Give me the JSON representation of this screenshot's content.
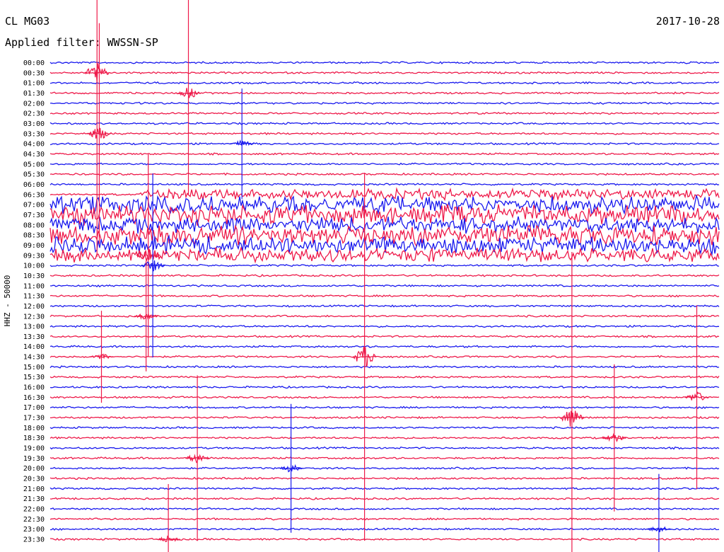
{
  "header": {
    "station": "CL MG03",
    "date": "2017-10-28",
    "filter_label": "Applied filter: WWSSN-SP"
  },
  "chart_data": {
    "type": "line",
    "title": "CL MG03",
    "subtitle": "Applied filter: WWSSN-SP",
    "ylabel": "HHZ - 50000",
    "xlabel": "",
    "y_ticks": [
      "00:00",
      "00:30",
      "01:00",
      "01:30",
      "02:00",
      "02:30",
      "03:00",
      "03:30",
      "04:00",
      "04:30",
      "05:00",
      "05:30",
      "06:00",
      "06:30",
      "07:00",
      "07:30",
      "08:00",
      "08:30",
      "09:00",
      "09:30",
      "10:00",
      "10:30",
      "11:00",
      "11:30",
      "12:00",
      "12:30",
      "13:00",
      "13:30",
      "14:00",
      "14:30",
      "15:00",
      "15:30",
      "16:00",
      "16:30",
      "17:00",
      "17:30",
      "18:00",
      "18:30",
      "19:00",
      "19:30",
      "20:00",
      "20:30",
      "21:00",
      "21:30",
      "22:00",
      "22:30",
      "23:00",
      "23:30"
    ],
    "trace_colors": [
      "#1a1aee",
      "#ee1a4a"
    ],
    "grid": false,
    "minutes_per_line": 30,
    "noisy_intervals": [
      {
        "line": "06:30",
        "from_min": 4,
        "to_min": 30,
        "level": 0.3
      },
      {
        "line": "07:00",
        "from_min": 0,
        "to_min": 30,
        "level": 0.5
      },
      {
        "line": "07:30",
        "from_min": 0,
        "to_min": 30,
        "level": 0.55
      },
      {
        "line": "08:00",
        "from_min": 0,
        "to_min": 30,
        "level": 0.45
      },
      {
        "line": "08:30",
        "from_min": 0,
        "to_min": 30,
        "level": 0.55
      },
      {
        "line": "09:00",
        "from_min": 0,
        "to_min": 30,
        "level": 0.5
      },
      {
        "line": "09:30",
        "from_min": 0,
        "to_min": 30,
        "level": 0.4
      }
    ],
    "events": [
      {
        "time": "00:30",
        "offset_min": 2.1,
        "amp": 1.0
      },
      {
        "time": "01:30",
        "offset_min": 6.2,
        "amp": 0.55
      },
      {
        "time": "03:30",
        "offset_min": 2.2,
        "amp": 0.6
      },
      {
        "time": "04:00",
        "offset_min": 8.6,
        "amp": 0.3
      },
      {
        "time": "09:30",
        "offset_min": 4.4,
        "amp": 0.55
      },
      {
        "time": "10:00",
        "offset_min": 4.6,
        "amp": 0.5
      },
      {
        "time": "12:30",
        "offset_min": 4.3,
        "amp": 0.3
      },
      {
        "time": "14:30",
        "offset_min": 14.1,
        "amp": 1.0
      },
      {
        "time": "14:30",
        "offset_min": 2.3,
        "amp": 0.25
      },
      {
        "time": "17:30",
        "offset_min": 23.4,
        "amp": 0.9
      },
      {
        "time": "16:30",
        "offset_min": 29.0,
        "amp": 0.5
      },
      {
        "time": "19:30",
        "offset_min": 6.6,
        "amp": 0.45
      },
      {
        "time": "20:00",
        "offset_min": 10.8,
        "amp": 0.35
      },
      {
        "time": "18:30",
        "offset_min": 25.3,
        "amp": 0.4
      },
      {
        "time": "23:00",
        "offset_min": 27.3,
        "amp": 0.3
      },
      {
        "time": "23:30",
        "offset_min": 5.3,
        "amp": 0.3
      }
    ]
  }
}
